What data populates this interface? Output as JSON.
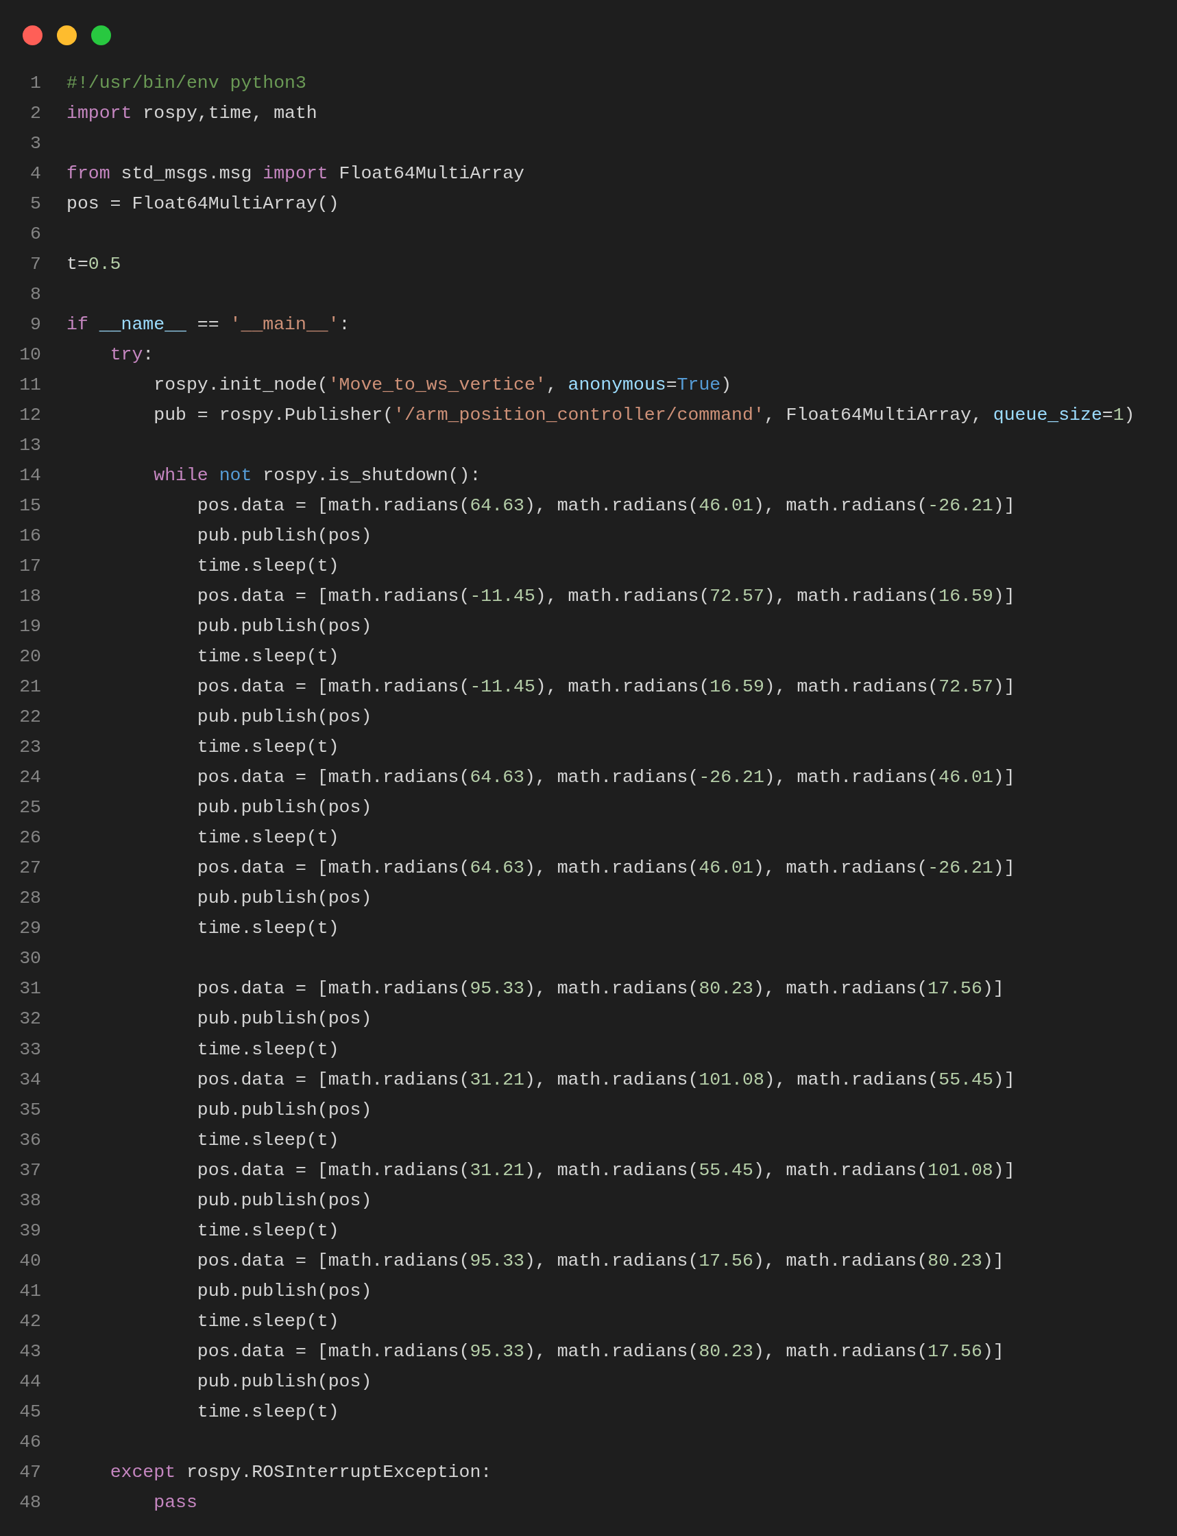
{
  "window_controls": [
    {
      "color": "#ff5f57"
    },
    {
      "color": "#febc2e"
    },
    {
      "color": "#28c840"
    }
  ],
  "lines": [
    {
      "number": "1",
      "tokens": [
        {
          "kind": "comment",
          "text": "#!/usr/bin/env python3"
        }
      ]
    },
    {
      "number": "2",
      "tokens": [
        {
          "kind": "keyword",
          "text": "import"
        },
        {
          "kind": "plain",
          "text": " rospy,time, math"
        }
      ]
    },
    {
      "number": "3"
    },
    {
      "number": "4",
      "tokens": [
        {
          "kind": "keyword",
          "text": "from"
        },
        {
          "kind": "plain",
          "text": " std_msgs.msg "
        },
        {
          "kind": "keyword",
          "text": "import"
        },
        {
          "kind": "plain",
          "text": " Float64MultiArray"
        }
      ]
    },
    {
      "number": "5",
      "tokens": [
        {
          "kind": "plain",
          "text": "pos = Float64MultiArray()"
        }
      ]
    },
    {
      "number": "6"
    },
    {
      "number": "7",
      "tokens": [
        {
          "kind": "plain",
          "text": "t="
        },
        {
          "kind": "number",
          "text": "0.5"
        }
      ]
    },
    {
      "number": "8"
    },
    {
      "number": "9",
      "tokens": [
        {
          "kind": "keyword",
          "text": "if "
        },
        {
          "kind": "param",
          "text": "__name__"
        },
        {
          "kind": "plain",
          "text": " == "
        },
        {
          "kind": "string",
          "text": "'__main__'"
        },
        {
          "kind": "plain",
          "text": ":"
        }
      ]
    },
    {
      "number": "10",
      "tokens": [
        {
          "kind": "keyword",
          "text": "    try"
        },
        {
          "kind": "plain",
          "text": ":"
        }
      ]
    },
    {
      "number": "11",
      "tokens": [
        {
          "kind": "plain",
          "text": "        rospy.init_node("
        },
        {
          "kind": "string",
          "text": "'Move_to_ws_vertice'"
        },
        {
          "kind": "plain",
          "text": ", "
        },
        {
          "kind": "param",
          "text": "anonymous"
        },
        {
          "kind": "plain",
          "text": "="
        },
        {
          "kind": "constant",
          "text": "True"
        },
        {
          "kind": "plain",
          "text": ")"
        }
      ]
    },
    {
      "number": "12",
      "tokens": [
        {
          "kind": "plain",
          "text": "        pub = rospy.Publisher("
        },
        {
          "kind": "string",
          "text": "'/arm_position_controller/command'"
        },
        {
          "kind": "plain",
          "text": ", Float64MultiArray, "
        },
        {
          "kind": "param",
          "text": "queue_size"
        },
        {
          "kind": "plain",
          "text": "="
        },
        {
          "kind": "number",
          "text": "1"
        },
        {
          "kind": "plain",
          "text": ")"
        }
      ]
    },
    {
      "number": "13"
    },
    {
      "number": "14",
      "tokens": [
        {
          "kind": "keyword",
          "text": "        while "
        },
        {
          "kind": "constant",
          "text": "not"
        },
        {
          "kind": "plain",
          "text": " rospy.is_shutdown():"
        }
      ]
    },
    {
      "number": "15",
      "tokens": [
        {
          "kind": "plain",
          "text": "            pos.data = [math.radians("
        },
        {
          "kind": "number",
          "text": "64.63"
        },
        {
          "kind": "plain",
          "text": "), math.radians("
        },
        {
          "kind": "number",
          "text": "46.01"
        },
        {
          "kind": "plain",
          "text": "), math.radians("
        },
        {
          "kind": "number",
          "text": "-26.21"
        },
        {
          "kind": "plain",
          "text": ")]"
        }
      ]
    },
    {
      "number": "16",
      "tokens": [
        {
          "kind": "plain",
          "text": "            pub.publish(pos)"
        }
      ]
    },
    {
      "number": "17",
      "tokens": [
        {
          "kind": "plain",
          "text": "            time.sleep(t)"
        }
      ]
    },
    {
      "number": "18",
      "tokens": [
        {
          "kind": "plain",
          "text": "            pos.data = [math.radians("
        },
        {
          "kind": "number",
          "text": "-11.45"
        },
        {
          "kind": "plain",
          "text": "), math.radians("
        },
        {
          "kind": "number",
          "text": "72.57"
        },
        {
          "kind": "plain",
          "text": "), math.radians("
        },
        {
          "kind": "number",
          "text": "16.59"
        },
        {
          "kind": "plain",
          "text": ")]"
        }
      ]
    },
    {
      "number": "19",
      "tokens": [
        {
          "kind": "plain",
          "text": "            pub.publish(pos)"
        }
      ]
    },
    {
      "number": "20",
      "tokens": [
        {
          "kind": "plain",
          "text": "            time.sleep(t)"
        }
      ]
    },
    {
      "number": "21",
      "tokens": [
        {
          "kind": "plain",
          "text": "            pos.data = [math.radians("
        },
        {
          "kind": "number",
          "text": "-11.45"
        },
        {
          "kind": "plain",
          "text": "), math.radians("
        },
        {
          "kind": "number",
          "text": "16.59"
        },
        {
          "kind": "plain",
          "text": "), math.radians("
        },
        {
          "kind": "number",
          "text": "72.57"
        },
        {
          "kind": "plain",
          "text": ")]"
        }
      ]
    },
    {
      "number": "22",
      "tokens": [
        {
          "kind": "plain",
          "text": "            pub.publish(pos)"
        }
      ]
    },
    {
      "number": "23",
      "tokens": [
        {
          "kind": "plain",
          "text": "            time.sleep(t)"
        }
      ]
    },
    {
      "number": "24",
      "tokens": [
        {
          "kind": "plain",
          "text": "            pos.data = [math.radians("
        },
        {
          "kind": "number",
          "text": "64.63"
        },
        {
          "kind": "plain",
          "text": "), math.radians("
        },
        {
          "kind": "number",
          "text": "-26.21"
        },
        {
          "kind": "plain",
          "text": "), math.radians("
        },
        {
          "kind": "number",
          "text": "46.01"
        },
        {
          "kind": "plain",
          "text": ")]"
        }
      ]
    },
    {
      "number": "25",
      "tokens": [
        {
          "kind": "plain",
          "text": "            pub.publish(pos)"
        }
      ]
    },
    {
      "number": "26",
      "tokens": [
        {
          "kind": "plain",
          "text": "            time.sleep(t)"
        }
      ]
    },
    {
      "number": "27",
      "tokens": [
        {
          "kind": "plain",
          "text": "            pos.data = [math.radians("
        },
        {
          "kind": "number",
          "text": "64.63"
        },
        {
          "kind": "plain",
          "text": "), math.radians("
        },
        {
          "kind": "number",
          "text": "46.01"
        },
        {
          "kind": "plain",
          "text": "), math.radians("
        },
        {
          "kind": "number",
          "text": "-26.21"
        },
        {
          "kind": "plain",
          "text": ")]"
        }
      ]
    },
    {
      "number": "28",
      "tokens": [
        {
          "kind": "plain",
          "text": "            pub.publish(pos)"
        }
      ]
    },
    {
      "number": "29",
      "tokens": [
        {
          "kind": "plain",
          "text": "            time.sleep(t)"
        }
      ]
    },
    {
      "number": "30"
    },
    {
      "number": "31",
      "tokens": [
        {
          "kind": "plain",
          "text": "            pos.data = [math.radians("
        },
        {
          "kind": "number",
          "text": "95.33"
        },
        {
          "kind": "plain",
          "text": "), math.radians("
        },
        {
          "kind": "number",
          "text": "80.23"
        },
        {
          "kind": "plain",
          "text": "), math.radians("
        },
        {
          "kind": "number",
          "text": "17.56"
        },
        {
          "kind": "plain",
          "text": ")]"
        }
      ]
    },
    {
      "number": "32",
      "tokens": [
        {
          "kind": "plain",
          "text": "            pub.publish(pos)"
        }
      ]
    },
    {
      "number": "33",
      "tokens": [
        {
          "kind": "plain",
          "text": "            time.sleep(t)"
        }
      ]
    },
    {
      "number": "34",
      "tokens": [
        {
          "kind": "plain",
          "text": "            pos.data = [math.radians("
        },
        {
          "kind": "number",
          "text": "31.21"
        },
        {
          "kind": "plain",
          "text": "), math.radians("
        },
        {
          "kind": "number",
          "text": "101.08"
        },
        {
          "kind": "plain",
          "text": "), math.radians("
        },
        {
          "kind": "number",
          "text": "55.45"
        },
        {
          "kind": "plain",
          "text": ")]"
        }
      ]
    },
    {
      "number": "35",
      "tokens": [
        {
          "kind": "plain",
          "text": "            pub.publish(pos)"
        }
      ]
    },
    {
      "number": "36",
      "tokens": [
        {
          "kind": "plain",
          "text": "            time.sleep(t)"
        }
      ]
    },
    {
      "number": "37",
      "tokens": [
        {
          "kind": "plain",
          "text": "            pos.data = [math.radians("
        },
        {
          "kind": "number",
          "text": "31.21"
        },
        {
          "kind": "plain",
          "text": "), math.radians("
        },
        {
          "kind": "number",
          "text": "55.45"
        },
        {
          "kind": "plain",
          "text": "), math.radians("
        },
        {
          "kind": "number",
          "text": "101.08"
        },
        {
          "kind": "plain",
          "text": ")]"
        }
      ]
    },
    {
      "number": "38",
      "tokens": [
        {
          "kind": "plain",
          "text": "            pub.publish(pos)"
        }
      ]
    },
    {
      "number": "39",
      "tokens": [
        {
          "kind": "plain",
          "text": "            time.sleep(t)"
        }
      ]
    },
    {
      "number": "40",
      "tokens": [
        {
          "kind": "plain",
          "text": "            pos.data = [math.radians("
        },
        {
          "kind": "number",
          "text": "95.33"
        },
        {
          "kind": "plain",
          "text": "), math.radians("
        },
        {
          "kind": "number",
          "text": "17.56"
        },
        {
          "kind": "plain",
          "text": "), math.radians("
        },
        {
          "kind": "number",
          "text": "80.23"
        },
        {
          "kind": "plain",
          "text": ")]"
        }
      ]
    },
    {
      "number": "41",
      "tokens": [
        {
          "kind": "plain",
          "text": "            pub.publish(pos)"
        }
      ]
    },
    {
      "number": "42",
      "tokens": [
        {
          "kind": "plain",
          "text": "            time.sleep(t)"
        }
      ]
    },
    {
      "number": "43",
      "tokens": [
        {
          "kind": "plain",
          "text": "            pos.data = [math.radians("
        },
        {
          "kind": "number",
          "text": "95.33"
        },
        {
          "kind": "plain",
          "text": "), math.radians("
        },
        {
          "kind": "number",
          "text": "80.23"
        },
        {
          "kind": "plain",
          "text": "), math.radians("
        },
        {
          "kind": "number",
          "text": "17.56"
        },
        {
          "kind": "plain",
          "text": ")]"
        }
      ]
    },
    {
      "number": "44",
      "tokens": [
        {
          "kind": "plain",
          "text": "            pub.publish(pos)"
        }
      ]
    },
    {
      "number": "45",
      "tokens": [
        {
          "kind": "plain",
          "text": "            time.sleep(t)"
        }
      ]
    },
    {
      "number": "46"
    },
    {
      "number": "47",
      "tokens": [
        {
          "kind": "keyword",
          "text": "    except"
        },
        {
          "kind": "plain",
          "text": " rospy.ROSInterruptException:"
        }
      ]
    },
    {
      "number": "48",
      "tokens": [
        {
          "kind": "keyword",
          "text": "        pass"
        }
      ]
    }
  ]
}
